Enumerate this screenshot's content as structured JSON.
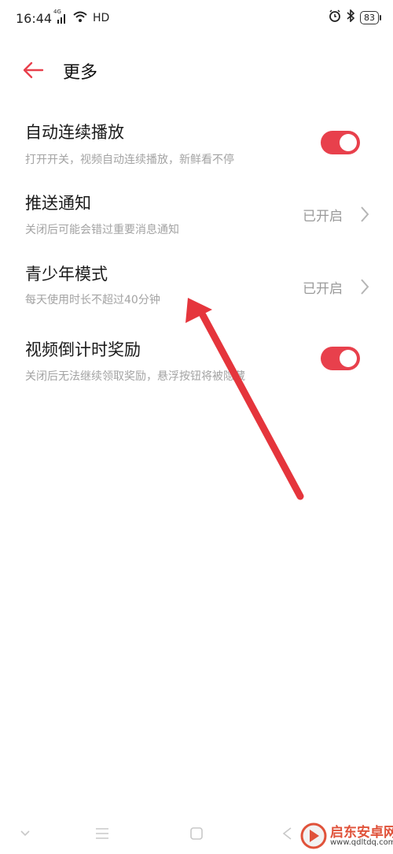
{
  "status_bar": {
    "time": "16:44",
    "network": "4G",
    "hd": "HD",
    "battery": "83"
  },
  "header": {
    "title": "更多",
    "accent_color": "#e8404c"
  },
  "settings": [
    {
      "title": "自动连续播放",
      "subtitle": "打开开关，视频自动连续播放，新鲜看不停",
      "control": "toggle",
      "on": true
    },
    {
      "title": "推送通知",
      "subtitle": "关闭后可能会错过重要消息通知",
      "control": "link",
      "status": "已开启"
    },
    {
      "title": "青少年模式",
      "subtitle": "每天使用时长不超过40分钟",
      "control": "link",
      "status": "已开启"
    },
    {
      "title": "视频倒计时奖励",
      "subtitle": "关闭后无法继续领取奖励，悬浮按钮将被隐藏",
      "control": "toggle",
      "on": true
    }
  ],
  "annotation": {
    "arrow_color": "#e5353c"
  },
  "watermark": {
    "title": "启东安卓网",
    "url": "www.qdltdq.com"
  }
}
